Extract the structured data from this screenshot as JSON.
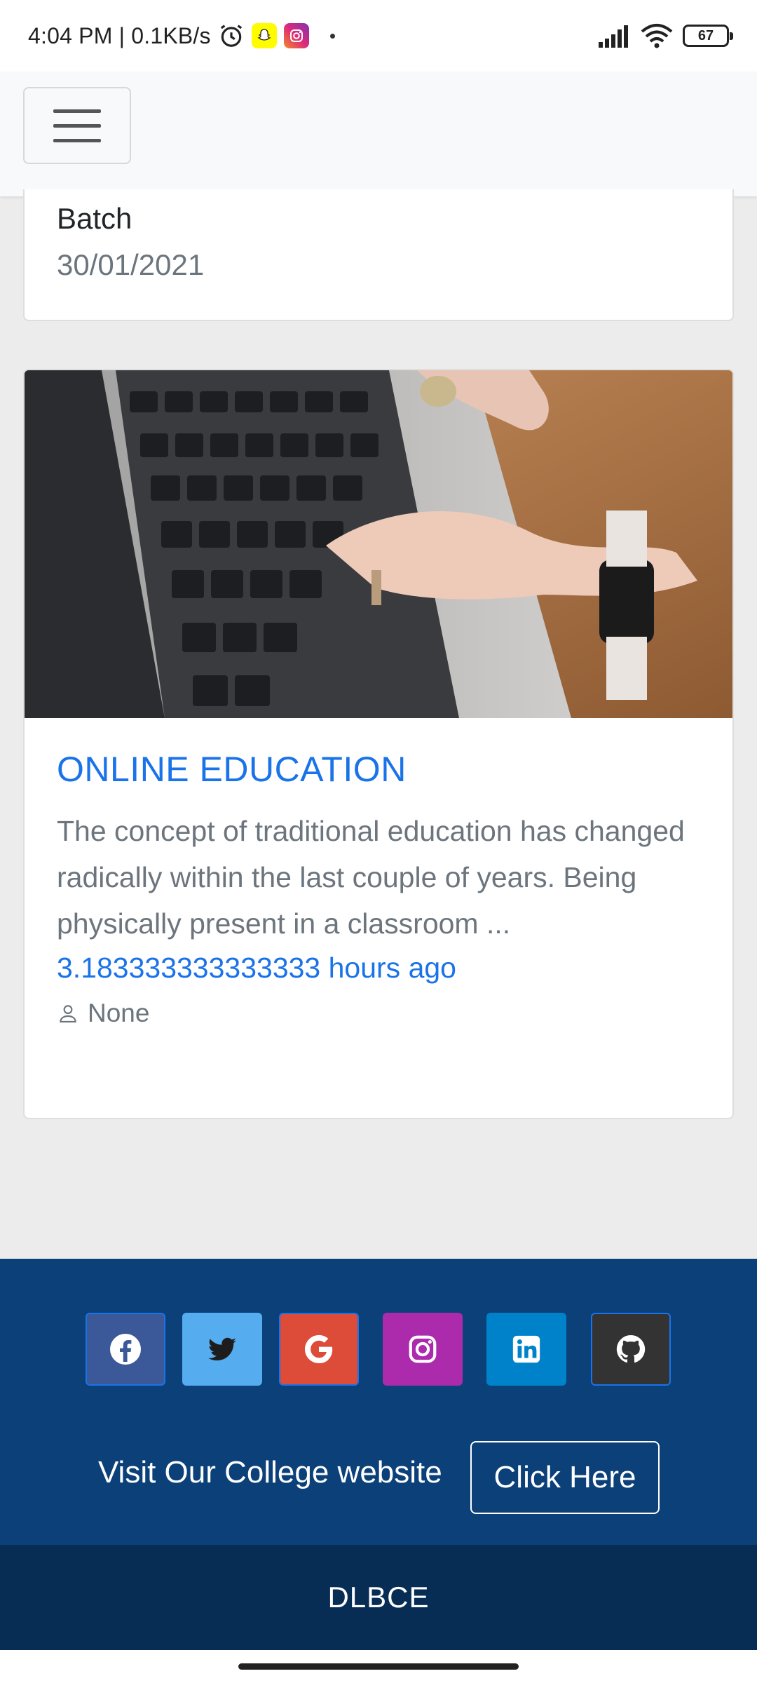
{
  "status_bar": {
    "time_speed": "4:04 PM | 0.1KB/s",
    "battery": "67"
  },
  "previous_card": {
    "field_label": "Batch",
    "date": "30/01/2021"
  },
  "post_card": {
    "title": "ONLINE EDUCATION",
    "excerpt": "The concept of traditional education has changed radically within the last couple of years. Being physically present in a classroom ...",
    "time_ago": "3.183333333333333 hours ago",
    "author": "None"
  },
  "footer": {
    "social": [
      {
        "name": "facebook",
        "color": "#3b5998"
      },
      {
        "name": "twitter",
        "color": "#55acee"
      },
      {
        "name": "google",
        "color": "#dd4b39"
      },
      {
        "name": "instagram",
        "color": "#ac2bac"
      },
      {
        "name": "linkedin",
        "color": "#0082ca"
      },
      {
        "name": "github",
        "color": "#333333"
      }
    ],
    "visit_text": "Visit Our College website",
    "click_label": "Click Here",
    "brand": "DLBCE"
  },
  "colors": {
    "accent_blue": "#1a73e8",
    "footer_bg": "#0b4079",
    "bottom_bar_bg": "#082d55"
  }
}
